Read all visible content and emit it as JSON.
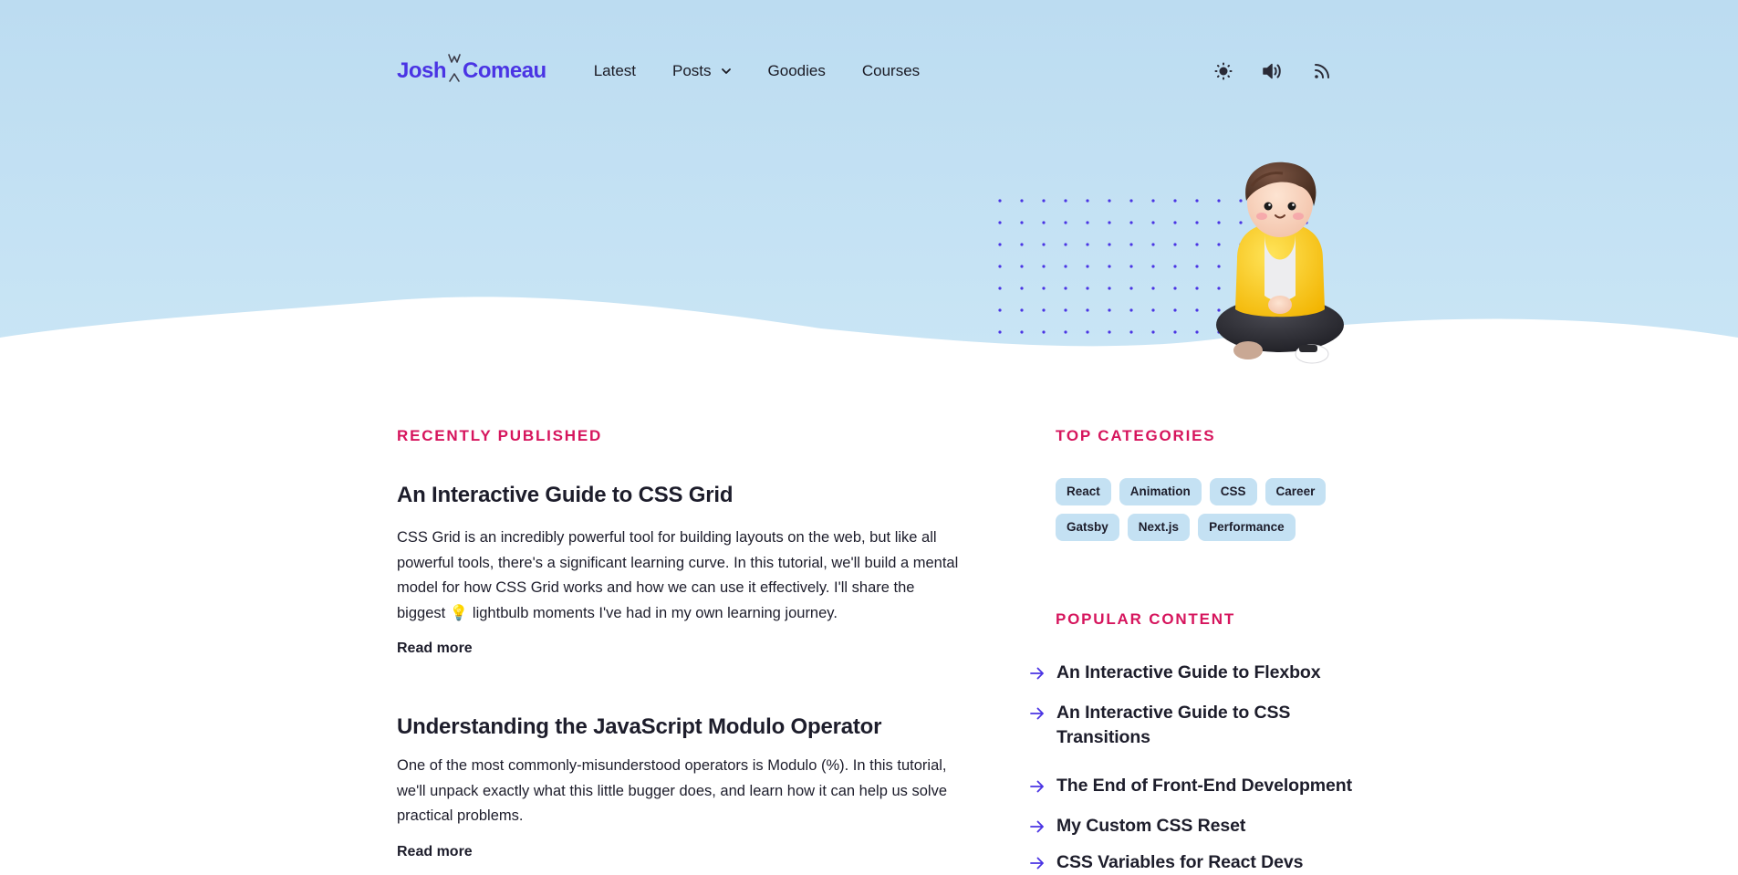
{
  "header": {
    "logo_first": "Josh",
    "logo_last": "Comeau",
    "nav": [
      {
        "label": "Latest"
      },
      {
        "label": "Posts"
      },
      {
        "label": "Goodies"
      },
      {
        "label": "Courses"
      }
    ]
  },
  "recently_published": {
    "heading": "Recently Published",
    "posts": [
      {
        "title": "An Interactive Guide to CSS Grid",
        "excerpt_before": "CSS Grid is an incredibly powerful tool for building layouts on the web, but like all powerful tools, there's a significant learning curve. In this tutorial, we'll build a mental model for how CSS Grid works and how we can use it effectively. I'll share the biggest ",
        "excerpt_emoji": "💡",
        "excerpt_after": " lightbulb moments I've had in my own learning journey.",
        "read_more": "Read more"
      },
      {
        "title": "Understanding the JavaScript Modulo Operator",
        "excerpt": "One of the most commonly-misunderstood operators is Modulo (%). In this tutorial, we'll unpack exactly what this little bugger does, and learn how it can help us solve practical problems.",
        "read_more": "Read more"
      }
    ]
  },
  "top_categories": {
    "heading": "Top Categories",
    "tags": [
      "React",
      "Animation",
      "CSS",
      "Career",
      "Gatsby",
      "Next.js",
      "Performance"
    ]
  },
  "popular_content": {
    "heading": "Popular Content",
    "items": [
      "An Interactive Guide to Flexbox",
      "An Interactive Guide to CSS Transitions",
      "The End of Front-End Development",
      "My Custom CSS Reset",
      "CSS Variables for React Devs"
    ]
  },
  "colors": {
    "hero_background": "#c2e0f3",
    "accent": "#d6155d",
    "brand": "#4a34e4",
    "tag_background": "#c4e1f3"
  },
  "icons": [
    "theme-toggle-sun-icon",
    "sound-toggle-icon",
    "rss-feed-icon",
    "arrow-right-icon",
    "chevron-down-icon"
  ]
}
